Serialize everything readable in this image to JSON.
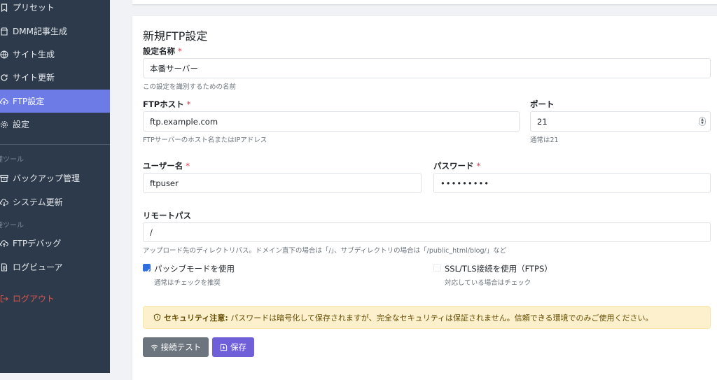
{
  "sidebar": {
    "items": [
      {
        "label": "プリセット",
        "icon": "bookmark-icon"
      },
      {
        "label": "DMM記事生成",
        "icon": "store-icon"
      },
      {
        "label": "サイト生成",
        "icon": "globe-icon"
      },
      {
        "label": "サイト更新",
        "icon": "refresh-icon"
      },
      {
        "label": "FTP設定",
        "icon": "cloud-upload-icon",
        "active": true
      },
      {
        "label": "設定",
        "icon": "gear-icon"
      }
    ],
    "section1": "理ツール",
    "items2": [
      {
        "label": "バックアップ管理",
        "icon": "archive-icon"
      },
      {
        "label": "システム更新",
        "icon": "cloud-download-icon"
      }
    ],
    "section2": "発ツール",
    "items3": [
      {
        "label": "FTPデバッグ",
        "icon": "cloud-debug-icon"
      },
      {
        "label": "ログビューア",
        "icon": "file-text-icon"
      }
    ],
    "logout": "ログアウト"
  },
  "form": {
    "title": "新規FTP設定",
    "required_mark": "*",
    "name": {
      "label": "設定名称",
      "value": "本番サーバー",
      "help": "この設定を識別するための名前"
    },
    "host": {
      "label": "FTPホスト",
      "value": "ftp.example.com",
      "help": "FTPサーバーのホスト名またはIPアドレス"
    },
    "port": {
      "label": "ポート",
      "value": "21",
      "help": "通常は21"
    },
    "user": {
      "label": "ユーザー名",
      "value": "ftpuser"
    },
    "password": {
      "label": "パスワード",
      "value": "•••••••••"
    },
    "remote": {
      "label": "リモートパス",
      "value": "/",
      "help": "アップロード先のディレクトリパス。ドメイン直下の場合は「/」、サブディレクトリの場合は「/public_html/blog/」など"
    },
    "passive": {
      "label": "パッシブモードを使用",
      "help": "通常はチェックを推奨",
      "checked": true
    },
    "ssl": {
      "label": "SSL/TLS接続を使用（FTPS）",
      "help": "対応している場合はチェック",
      "checked": false
    }
  },
  "alert": {
    "title": "セキュリティ注意:",
    "text": "パスワードは暗号化して保存されますが、完全なセキュリティは保証されません。信頼できる環境でのみご使用ください。"
  },
  "buttons": {
    "test": "接続テスト",
    "save": "保存"
  },
  "colors": {
    "sidebar_bg": "#2c3a4b",
    "active": "#6c7be6",
    "test_btn": "#6c757d",
    "save_btn": "#6f5fd8",
    "alert_bg": "#fdf1cd"
  }
}
